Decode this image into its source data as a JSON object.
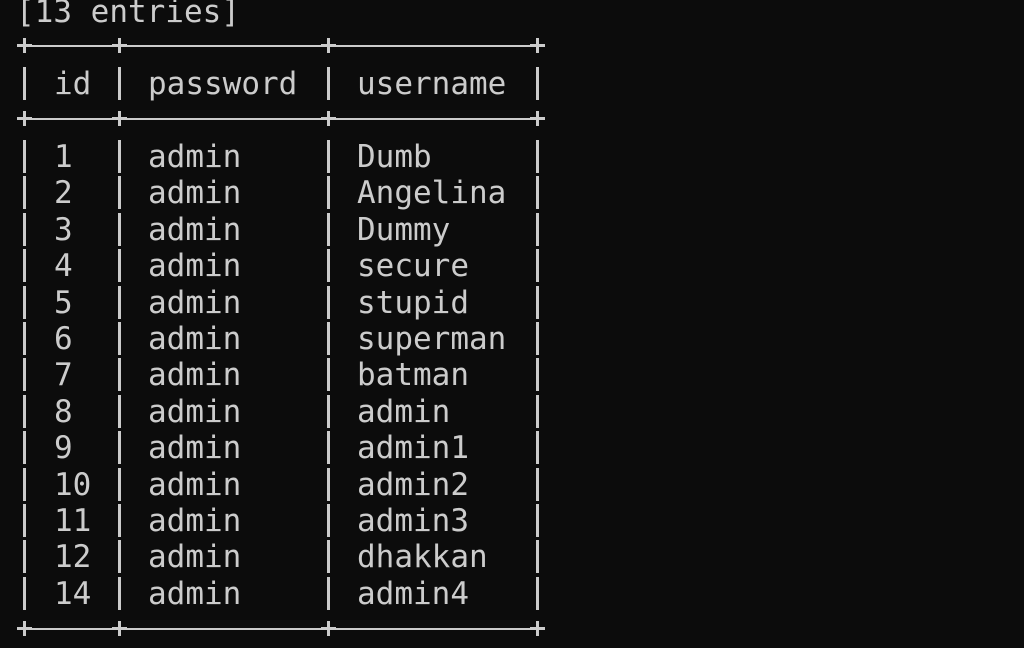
{
  "summary": "[13 entries]",
  "columns": [
    "id",
    "password",
    "username"
  ],
  "rows": [
    {
      "id": "1",
      "password": "admin",
      "username": "Dumb"
    },
    {
      "id": "2",
      "password": "admin",
      "username": "Angelina"
    },
    {
      "id": "3",
      "password": "admin",
      "username": "Dummy"
    },
    {
      "id": "4",
      "password": "admin",
      "username": "secure"
    },
    {
      "id": "5",
      "password": "admin",
      "username": "stupid"
    },
    {
      "id": "6",
      "password": "admin",
      "username": "superman"
    },
    {
      "id": "7",
      "password": "admin",
      "username": "batman"
    },
    {
      "id": "8",
      "password": "admin",
      "username": "admin"
    },
    {
      "id": "9",
      "password": "admin",
      "username": "admin1"
    },
    {
      "id": "10",
      "password": "admin",
      "username": "admin2"
    },
    {
      "id": "11",
      "password": "admin",
      "username": "admin3"
    },
    {
      "id": "12",
      "password": "admin",
      "username": "dhakkan"
    },
    {
      "id": "14",
      "password": "admin",
      "username": "admin4"
    }
  ],
  "colors": {
    "background": "#0c0c0c",
    "foreground": "#cccccc"
  }
}
